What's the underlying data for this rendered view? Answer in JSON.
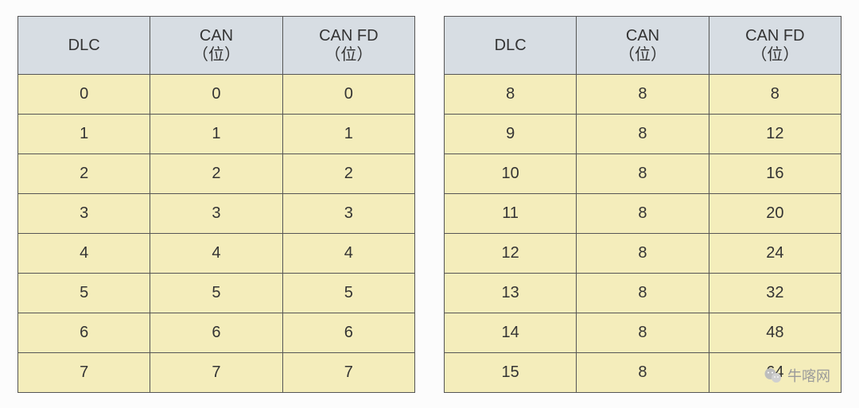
{
  "chart_data": [
    {
      "type": "table",
      "columns": [
        {
          "main": "DLC",
          "sub": ""
        },
        {
          "main": "CAN",
          "sub": "（位）"
        },
        {
          "main": "CAN FD",
          "sub": "（位）"
        }
      ],
      "rows": [
        [
          0,
          0,
          0
        ],
        [
          1,
          1,
          1
        ],
        [
          2,
          2,
          2
        ],
        [
          3,
          3,
          3
        ],
        [
          4,
          4,
          4
        ],
        [
          5,
          5,
          5
        ],
        [
          6,
          6,
          6
        ],
        [
          7,
          7,
          7
        ]
      ]
    },
    {
      "type": "table",
      "columns": [
        {
          "main": "DLC",
          "sub": ""
        },
        {
          "main": "CAN",
          "sub": "（位）"
        },
        {
          "main": "CAN FD",
          "sub": "（位）"
        }
      ],
      "rows": [
        [
          8,
          8,
          8
        ],
        [
          9,
          8,
          12
        ],
        [
          10,
          8,
          16
        ],
        [
          11,
          8,
          20
        ],
        [
          12,
          8,
          24
        ],
        [
          13,
          8,
          32
        ],
        [
          14,
          8,
          48
        ],
        [
          15,
          8,
          64
        ]
      ]
    }
  ],
  "watermark": {
    "icon_name": "wechat-icon",
    "text": "牛喀网"
  }
}
